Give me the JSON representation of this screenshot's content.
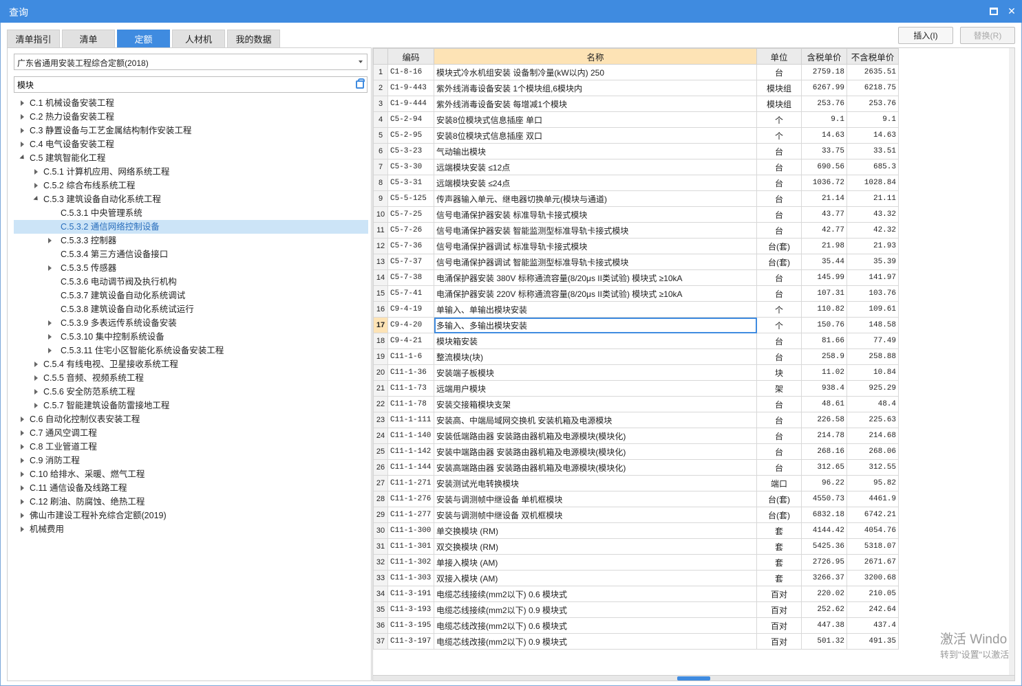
{
  "window": {
    "title": "查询"
  },
  "tabs": [
    {
      "label": "清单指引",
      "active": false
    },
    {
      "label": "清单",
      "active": false
    },
    {
      "label": "定额",
      "active": true
    },
    {
      "label": "人材机",
      "active": false
    },
    {
      "label": "我的数据",
      "active": false
    }
  ],
  "buttons": {
    "insert": "插入(I)",
    "replace": "替换(R)"
  },
  "left": {
    "library": "广东省通用安装工程综合定额(2018)",
    "search_value": "模块",
    "tree": [
      {
        "label": "C.1 机械设备安装工程",
        "level": 0,
        "state": "collapsed"
      },
      {
        "label": "C.2 热力设备安装工程",
        "level": 0,
        "state": "collapsed"
      },
      {
        "label": "C.3 静置设备与工艺金属结构制作安装工程",
        "level": 0,
        "state": "collapsed"
      },
      {
        "label": "C.4 电气设备安装工程",
        "level": 0,
        "state": "collapsed"
      },
      {
        "label": "C.5 建筑智能化工程",
        "level": 0,
        "state": "expanded"
      },
      {
        "label": "C.5.1 计算机应用、网络系统工程",
        "level": 1,
        "state": "collapsed"
      },
      {
        "label": "C.5.2 综合布线系统工程",
        "level": 1,
        "state": "collapsed"
      },
      {
        "label": "C.5.3 建筑设备自动化系统工程",
        "level": 1,
        "state": "expanded"
      },
      {
        "label": "C.5.3.1 中央管理系统",
        "level": 2,
        "state": "leaf"
      },
      {
        "label": "C.5.3.2 通信网络控制设备",
        "level": 2,
        "state": "leaf",
        "selected": true
      },
      {
        "label": "C.5.3.3 控制器",
        "level": 2,
        "state": "collapsed"
      },
      {
        "label": "C.5.3.4 第三方通信设备接口",
        "level": 2,
        "state": "leaf"
      },
      {
        "label": "C.5.3.5 传感器",
        "level": 2,
        "state": "collapsed"
      },
      {
        "label": "C.5.3.6 电动调节阀及执行机构",
        "level": 2,
        "state": "leaf"
      },
      {
        "label": "C.5.3.7 建筑设备自动化系统调试",
        "level": 2,
        "state": "leaf"
      },
      {
        "label": "C.5.3.8 建筑设备自动化系统试运行",
        "level": 2,
        "state": "leaf"
      },
      {
        "label": "C.5.3.9 多表远传系统设备安装",
        "level": 2,
        "state": "collapsed"
      },
      {
        "label": "C.5.3.10 集中控制系统设备",
        "level": 2,
        "state": "collapsed"
      },
      {
        "label": "C.5.3.11 住宅小区智能化系统设备安装工程",
        "level": 2,
        "state": "collapsed"
      },
      {
        "label": "C.5.4 有线电视、卫星接收系统工程",
        "level": 1,
        "state": "collapsed"
      },
      {
        "label": "C.5.5 音频、视频系统工程",
        "level": 1,
        "state": "collapsed"
      },
      {
        "label": "C.5.6 安全防范系统工程",
        "level": 1,
        "state": "collapsed"
      },
      {
        "label": "C.5.7 智能建筑设备防雷接地工程",
        "level": 1,
        "state": "collapsed"
      },
      {
        "label": "C.6 自动化控制仪表安装工程",
        "level": 0,
        "state": "collapsed"
      },
      {
        "label": "C.7 通风空调工程",
        "level": 0,
        "state": "collapsed"
      },
      {
        "label": "C.8 工业管道工程",
        "level": 0,
        "state": "collapsed"
      },
      {
        "label": "C.9 消防工程",
        "level": 0,
        "state": "collapsed"
      },
      {
        "label": "C.10 给排水、采暖、燃气工程",
        "level": 0,
        "state": "collapsed"
      },
      {
        "label": "C.11 通信设备及线路工程",
        "level": 0,
        "state": "collapsed"
      },
      {
        "label": "C.12 刷油、防腐蚀、绝热工程",
        "level": 0,
        "state": "collapsed"
      },
      {
        "label": "佛山市建设工程补充综合定额(2019)",
        "level": 0,
        "state": "collapsed"
      },
      {
        "label": "机械费用",
        "level": 0,
        "state": "collapsed"
      }
    ]
  },
  "grid": {
    "columns": [
      "编码",
      "名称",
      "单位",
      "含税单价",
      "不含税单价"
    ],
    "active_row": 17,
    "rows": [
      {
        "n": "1",
        "code": "C1-8-16",
        "name": "模块式冷水机组安装 设备制冷量(kW以内) 250",
        "unit": "台",
        "tax": "2759.18",
        "notax": "2635.51"
      },
      {
        "n": "2",
        "code": "C1-9-443",
        "name": "紫外线消毒设备安装 1个模块组,6模块内",
        "unit": "模块组",
        "tax": "6267.99",
        "notax": "6218.75"
      },
      {
        "n": "3",
        "code": "C1-9-444",
        "name": "紫外线消毒设备安装 每增减1个模块",
        "unit": "模块组",
        "tax": "253.76",
        "notax": "253.76"
      },
      {
        "n": "4",
        "code": "C5-2-94",
        "name": "安装8位模块式信息插座 单口",
        "unit": "个",
        "tax": "9.1",
        "notax": "9.1"
      },
      {
        "n": "5",
        "code": "C5-2-95",
        "name": "安装8位模块式信息插座 双口",
        "unit": "个",
        "tax": "14.63",
        "notax": "14.63"
      },
      {
        "n": "6",
        "code": "C5-3-23",
        "name": "气动输出模块",
        "unit": "台",
        "tax": "33.75",
        "notax": "33.51"
      },
      {
        "n": "7",
        "code": "C5-3-30",
        "name": "远端模块安装 ≤12点",
        "unit": "台",
        "tax": "690.56",
        "notax": "685.3"
      },
      {
        "n": "8",
        "code": "C5-3-31",
        "name": "远端模块安装 ≤24点",
        "unit": "台",
        "tax": "1036.72",
        "notax": "1028.84"
      },
      {
        "n": "9",
        "code": "C5-5-125",
        "name": "传声器输入单元、继电器切换单元(模块与通道)",
        "unit": "台",
        "tax": "21.14",
        "notax": "21.11"
      },
      {
        "n": "10",
        "code": "C5-7-25",
        "name": "信号电涌保护器安装 标准导轨卡接式模块",
        "unit": "台",
        "tax": "43.77",
        "notax": "43.32"
      },
      {
        "n": "11",
        "code": "C5-7-26",
        "name": "信号电涌保护器安装 智能监测型标准导轨卡接式模块",
        "unit": "台",
        "tax": "42.77",
        "notax": "42.32"
      },
      {
        "n": "12",
        "code": "C5-7-36",
        "name": "信号电涌保护器调试 标准导轨卡接式模块",
        "unit": "台(套)",
        "tax": "21.98",
        "notax": "21.93"
      },
      {
        "n": "13",
        "code": "C5-7-37",
        "name": "信号电涌保护器调试 智能监测型标准导轨卡接式模块",
        "unit": "台(套)",
        "tax": "35.44",
        "notax": "35.39"
      },
      {
        "n": "14",
        "code": "C5-7-38",
        "name": "电涌保护器安装 380V 标称通流容量(8/20μs II类试验) 模块式 ≥10kA",
        "unit": "台",
        "tax": "145.99",
        "notax": "141.97"
      },
      {
        "n": "15",
        "code": "C5-7-41",
        "name": "电涌保护器安装 220V 标称通流容量(8/20μs II类试验) 模块式 ≥10kA",
        "unit": "台",
        "tax": "107.31",
        "notax": "103.76"
      },
      {
        "n": "16",
        "code": "C9-4-19",
        "name": "单输入、单输出模块安装",
        "unit": "个",
        "tax": "110.82",
        "notax": "109.61"
      },
      {
        "n": "17",
        "code": "C9-4-20",
        "name": "多输入、多输出模块安装",
        "unit": "个",
        "tax": "150.76",
        "notax": "148.58"
      },
      {
        "n": "18",
        "code": "C9-4-21",
        "name": "模块箱安装",
        "unit": "台",
        "tax": "81.66",
        "notax": "77.49"
      },
      {
        "n": "19",
        "code": "C11-1-6",
        "name": "整流模块(块)",
        "unit": "台",
        "tax": "258.9",
        "notax": "258.88"
      },
      {
        "n": "20",
        "code": "C11-1-36",
        "name": "安装端子板模块",
        "unit": "块",
        "tax": "11.02",
        "notax": "10.84"
      },
      {
        "n": "21",
        "code": "C11-1-73",
        "name": "远端用户模块",
        "unit": "架",
        "tax": "938.4",
        "notax": "925.29"
      },
      {
        "n": "22",
        "code": "C11-1-78",
        "name": "安装交接箱模块支架",
        "unit": "台",
        "tax": "48.61",
        "notax": "48.4"
      },
      {
        "n": "23",
        "code": "C11-1-111",
        "name": "安装高、中端局域网交换机 安装机箱及电源模块",
        "unit": "台",
        "tax": "226.58",
        "notax": "225.63"
      },
      {
        "n": "24",
        "code": "C11-1-140",
        "name": "安装低端路由器 安装路由器机箱及电源模块(模块化)",
        "unit": "台",
        "tax": "214.78",
        "notax": "214.68"
      },
      {
        "n": "25",
        "code": "C11-1-142",
        "name": "安装中端路由器 安装路由器机箱及电源模块(模块化)",
        "unit": "台",
        "tax": "268.16",
        "notax": "268.06"
      },
      {
        "n": "26",
        "code": "C11-1-144",
        "name": "安装高端路由器 安装路由器机箱及电源模块(模块化)",
        "unit": "台",
        "tax": "312.65",
        "notax": "312.55"
      },
      {
        "n": "27",
        "code": "C11-1-271",
        "name": "安装测试光电转换模块",
        "unit": "端口",
        "tax": "96.22",
        "notax": "95.82"
      },
      {
        "n": "28",
        "code": "C11-1-276",
        "name": "安装与调测帧中继设备 单机框模块",
        "unit": "台(套)",
        "tax": "4550.73",
        "notax": "4461.9"
      },
      {
        "n": "29",
        "code": "C11-1-277",
        "name": "安装与调测帧中继设备 双机框模块",
        "unit": "台(套)",
        "tax": "6832.18",
        "notax": "6742.21"
      },
      {
        "n": "30",
        "code": "C11-1-300",
        "name": "单交换模块 (RM)",
        "unit": "套",
        "tax": "4144.42",
        "notax": "4054.76"
      },
      {
        "n": "31",
        "code": "C11-1-301",
        "name": "双交换模块 (RM)",
        "unit": "套",
        "tax": "5425.36",
        "notax": "5318.07"
      },
      {
        "n": "32",
        "code": "C11-1-302",
        "name": "单接入模块 (AM)",
        "unit": "套",
        "tax": "2726.95",
        "notax": "2671.67"
      },
      {
        "n": "33",
        "code": "C11-1-303",
        "name": "双接入模块 (AM)",
        "unit": "套",
        "tax": "3266.37",
        "notax": "3200.68"
      },
      {
        "n": "34",
        "code": "C11-3-191",
        "name": "电缆芯线接续(mm2以下) 0.6 模块式",
        "unit": "百对",
        "tax": "220.02",
        "notax": "210.05"
      },
      {
        "n": "35",
        "code": "C11-3-193",
        "name": "电缆芯线接续(mm2以下) 0.9 模块式",
        "unit": "百对",
        "tax": "252.62",
        "notax": "242.64"
      },
      {
        "n": "36",
        "code": "C11-3-195",
        "name": "电缆芯线改接(mm2以下) 0.6 模块式",
        "unit": "百对",
        "tax": "447.38",
        "notax": "437.4"
      },
      {
        "n": "37",
        "code": "C11-3-197",
        "name": "电缆芯线改接(mm2以下) 0.9 模块式",
        "unit": "百对",
        "tax": "501.32",
        "notax": "491.35"
      }
    ]
  },
  "watermark": {
    "line1": "激活 Windo",
    "line2": "转到\"设置\"以激活"
  }
}
